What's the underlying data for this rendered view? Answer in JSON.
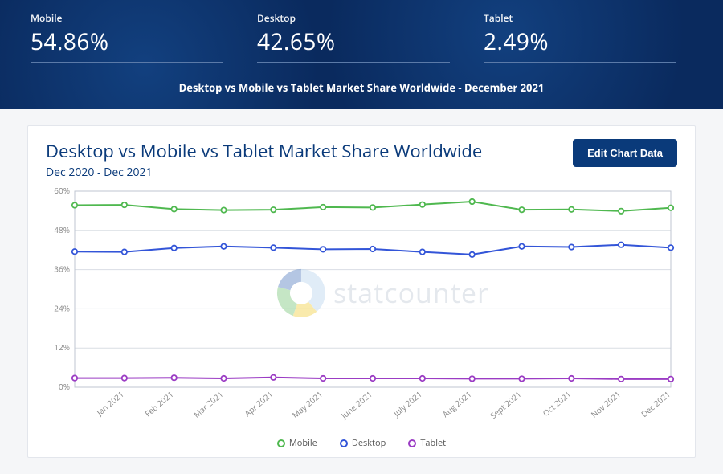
{
  "hero": {
    "stats": [
      {
        "label": "Mobile",
        "value": "54.86%"
      },
      {
        "label": "Desktop",
        "value": "42.65%"
      },
      {
        "label": "Tablet",
        "value": "2.49%"
      }
    ],
    "title": "Desktop vs Mobile vs Tablet Market Share Worldwide - December 2021"
  },
  "card": {
    "title": "Desktop vs Mobile vs Tablet Market Share Worldwide",
    "subtitle": "Dec 2020 - Dec 2021",
    "edit_label": "Edit Chart Data",
    "watermark": "statcounter"
  },
  "legend": {
    "mobile": "Mobile",
    "desktop": "Desktop",
    "tablet": "Tablet"
  },
  "colors": {
    "mobile": "#4fb84f",
    "desktop": "#3355d8",
    "tablet": "#9b3cc4",
    "grid": "#d9dde4",
    "axis": "#888"
  },
  "chart_data": {
    "type": "line",
    "title": "Desktop vs Mobile vs Tablet Market Share Worldwide",
    "xlabel": "",
    "ylabel": "",
    "ylim": [
      0,
      60
    ],
    "yticks": [
      0,
      12,
      24,
      36,
      48,
      60
    ],
    "ytick_labels": [
      "0%",
      "12%",
      "24%",
      "36%",
      "48%",
      "60%"
    ],
    "categories": [
      "Dec 2020",
      "Jan 2021",
      "Feb 2021",
      "Mar 2021",
      "Apr 2021",
      "May 2021",
      "June 2021",
      "July 2021",
      "Aug 2021",
      "Sept 2021",
      "Oct 2021",
      "Nov 2021",
      "Dec 2021"
    ],
    "xtick_labels": [
      "Jan 2021",
      "Feb 2021",
      "Mar 2021",
      "Apr 2021",
      "May 2021",
      "June 2021",
      "July 2021",
      "Aug 2021",
      "Sept 2021",
      "Oct 2021",
      "Nov 2021",
      "Dec 2021"
    ],
    "series": [
      {
        "name": "Mobile",
        "color": "#4fb84f",
        "values": [
          55.7,
          55.8,
          54.5,
          54.2,
          54.3,
          55.1,
          55.0,
          55.9,
          56.8,
          54.3,
          54.4,
          53.9,
          54.9
        ]
      },
      {
        "name": "Desktop",
        "color": "#3355d8",
        "values": [
          41.5,
          41.4,
          42.6,
          43.1,
          42.7,
          42.2,
          42.3,
          41.4,
          40.6,
          43.1,
          42.9,
          43.6,
          42.7
        ]
      },
      {
        "name": "Tablet",
        "color": "#9b3cc4",
        "values": [
          2.8,
          2.8,
          2.9,
          2.7,
          3.0,
          2.7,
          2.7,
          2.7,
          2.6,
          2.6,
          2.7,
          2.5,
          2.5
        ]
      }
    ]
  }
}
